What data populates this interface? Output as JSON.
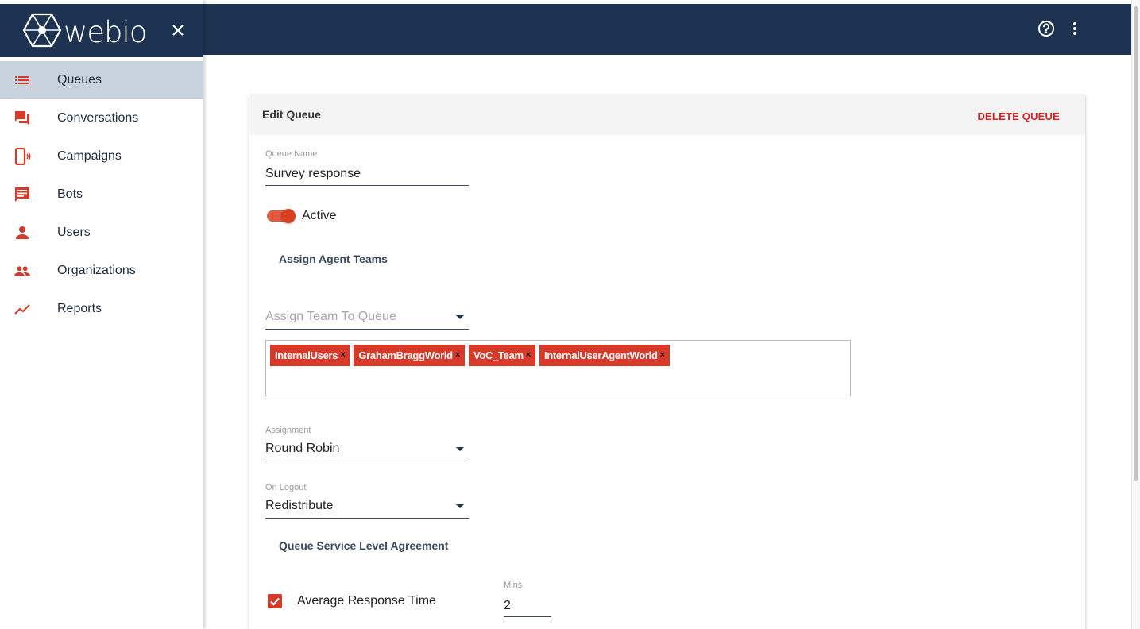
{
  "app": {
    "name": "webio"
  },
  "topbar": {
    "help_icon": "help-circle-icon",
    "more_icon": "more-vert-icon"
  },
  "sidebar": {
    "items": [
      {
        "label": "Queues",
        "icon": "list-icon",
        "active": true
      },
      {
        "label": "Conversations",
        "icon": "forum-icon",
        "active": false
      },
      {
        "label": "Campaigns",
        "icon": "phone-broadcast-icon",
        "active": false
      },
      {
        "label": "Bots",
        "icon": "chat-icon",
        "active": false
      },
      {
        "label": "Users",
        "icon": "person-icon",
        "active": false
      },
      {
        "label": "Organizations",
        "icon": "people-icon",
        "active": false
      },
      {
        "label": "Reports",
        "icon": "trending-up-icon",
        "active": false
      }
    ]
  },
  "card": {
    "title": "Edit Queue",
    "delete_label": "DELETE QUEUE",
    "queue_name": {
      "label": "Queue Name",
      "value": "Survey response"
    },
    "active": {
      "label": "Active",
      "on": true
    },
    "teams_section": "Assign Agent Teams",
    "team_select": {
      "placeholder": "Assign Team To Queue"
    },
    "teams": [
      "InternalUsers",
      "GrahamBraggWorld",
      "VoC_Team",
      "InternalUserAgentWorld"
    ],
    "chip_remove": "×",
    "assignment": {
      "label": "Assignment",
      "value": "Round Robin"
    },
    "on_logout": {
      "label": "On Logout",
      "value": "Redistribute"
    },
    "sla_section": "Queue Service Level Agreement",
    "avg_response": {
      "label": "Average Response Time",
      "checked": true,
      "unit_label": "Mins",
      "value": "2"
    }
  },
  "colors": {
    "navy": "#1d3351",
    "accent": "#d63a2a",
    "active_nav": "#c9d3dd"
  }
}
